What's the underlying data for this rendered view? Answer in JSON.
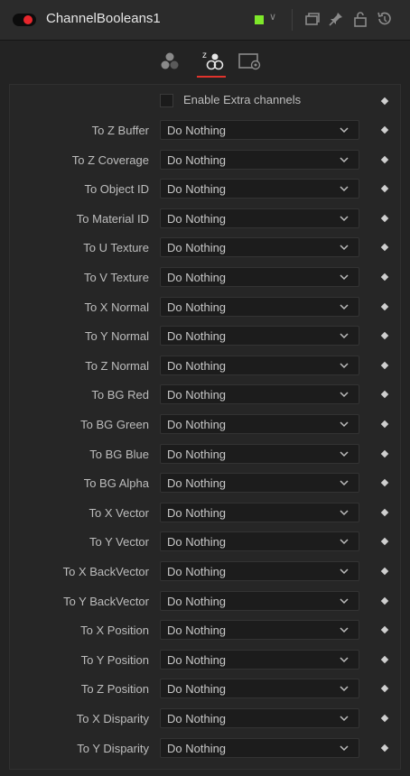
{
  "header": {
    "title": "ChannelBooleans1",
    "swatch_color": "#7ee82a",
    "close_color": "#e8262c"
  },
  "tabs": [
    {
      "icon": "color-channels-icon",
      "active": false
    },
    {
      "icon": "z-channels-icon",
      "active": true
    },
    {
      "icon": "settings-icon",
      "active": false
    }
  ],
  "extra_channels": {
    "label": "Enable Extra channels",
    "checked": false
  },
  "rows": [
    {
      "label": "To Z Buffer",
      "value": "Do Nothing"
    },
    {
      "label": "To Z Coverage",
      "value": "Do Nothing"
    },
    {
      "label": "To Object ID",
      "value": "Do Nothing"
    },
    {
      "label": "To Material ID",
      "value": "Do Nothing"
    },
    {
      "label": "To U Texture",
      "value": "Do Nothing"
    },
    {
      "label": "To V Texture",
      "value": "Do Nothing"
    },
    {
      "label": "To X Normal",
      "value": "Do Nothing"
    },
    {
      "label": "To Y Normal",
      "value": "Do Nothing"
    },
    {
      "label": "To Z Normal",
      "value": "Do Nothing"
    },
    {
      "label": "To BG Red",
      "value": "Do Nothing"
    },
    {
      "label": "To BG Green",
      "value": "Do Nothing"
    },
    {
      "label": "To BG Blue",
      "value": "Do Nothing"
    },
    {
      "label": "To BG Alpha",
      "value": "Do Nothing"
    },
    {
      "label": "To X Vector",
      "value": "Do Nothing"
    },
    {
      "label": "To Y Vector",
      "value": "Do Nothing"
    },
    {
      "label": "To X BackVector",
      "value": "Do Nothing"
    },
    {
      "label": "To Y BackVector",
      "value": "Do Nothing"
    },
    {
      "label": "To X Position",
      "value": "Do Nothing"
    },
    {
      "label": "To Y Position",
      "value": "Do Nothing"
    },
    {
      "label": "To Z Position",
      "value": "Do Nothing"
    },
    {
      "label": "To X Disparity",
      "value": "Do Nothing"
    },
    {
      "label": "To Y Disparity",
      "value": "Do Nothing"
    }
  ]
}
